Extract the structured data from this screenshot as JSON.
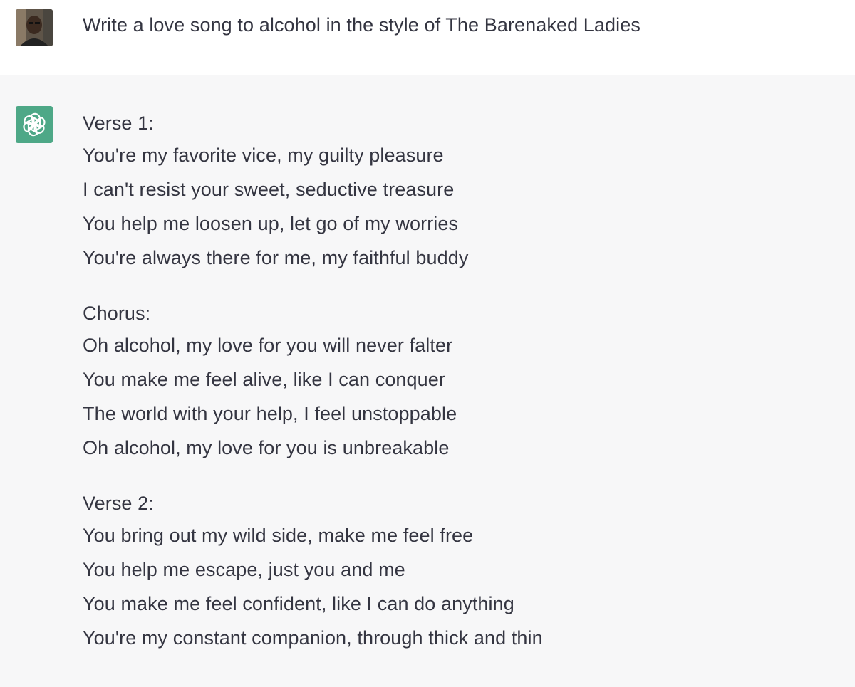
{
  "user_message": {
    "avatar_icon": "user-photo-avatar",
    "text": "Write a love song to alcohol in the style of The Barenaked Ladies"
  },
  "assistant_message": {
    "avatar_icon": "openai-logo-icon",
    "avatar_color": "#4ea887",
    "stanzas": [
      {
        "heading": "Verse 1:",
        "lines": [
          "You're my favorite vice, my guilty pleasure",
          "I can't resist your sweet, seductive treasure",
          "You help me loosen up, let go of my worries",
          "You're always there for me, my faithful buddy"
        ]
      },
      {
        "heading": "Chorus:",
        "lines": [
          "Oh alcohol, my love for you will never falter",
          "You make me feel alive, like I can conquer",
          "The world with your help, I feel unstoppable",
          "Oh alcohol, my love for you is unbreakable"
        ]
      },
      {
        "heading": "Verse 2:",
        "lines": [
          "You bring out my wild side, make me feel free",
          "You help me escape, just you and me",
          "You make me feel confident, like I can do anything",
          "You're my constant companion, through thick and thin"
        ]
      }
    ]
  }
}
